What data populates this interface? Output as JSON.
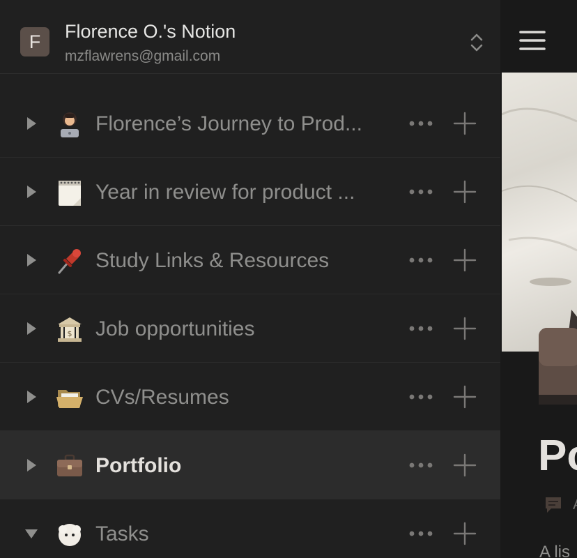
{
  "workspace": {
    "avatar_letter": "F",
    "name": "Florence O.'s Notion",
    "email": "mzflawrens@gmail.com"
  },
  "sidebar": {
    "pages": [
      {
        "title": "Florence’s Journey to Prod...",
        "icon": "woman-technologist-icon",
        "expanded": false,
        "active": false
      },
      {
        "title": "Year in review for product ...",
        "icon": "spiral-notepad-icon",
        "expanded": false,
        "active": false
      },
      {
        "title": "Study Links & Resources",
        "icon": "pushpin-icon",
        "expanded": false,
        "active": false
      },
      {
        "title": "Job opportunities",
        "icon": "bank-icon",
        "expanded": false,
        "active": false
      },
      {
        "title": "CVs/Resumes",
        "icon": "open-folder-icon",
        "expanded": false,
        "active": false
      },
      {
        "title": "Portfolio",
        "icon": "briefcase-icon",
        "expanded": false,
        "active": true
      },
      {
        "title": "Tasks",
        "icon": "fluffy-creature-icon",
        "expanded": true,
        "active": false
      }
    ]
  },
  "content": {
    "heading_partial": "Po",
    "property_partial": "A",
    "description_partial": "A lis"
  },
  "colors": {
    "sidebar_bg": "#202020",
    "active_row_bg": "#2c2c2c",
    "text_muted": "#8f8f8d",
    "text_active": "#e4e1dd"
  }
}
